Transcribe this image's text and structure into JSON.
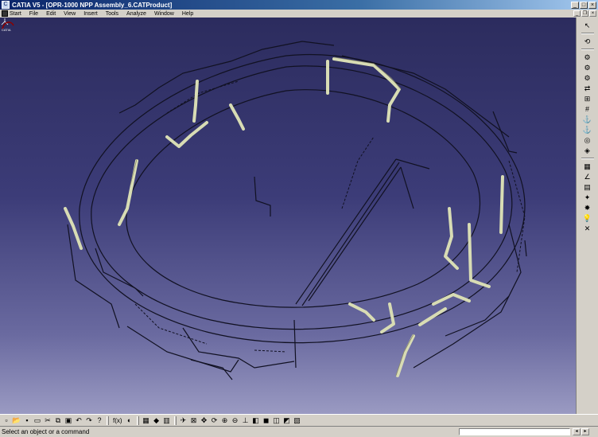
{
  "window": {
    "title": "CATIA V5 - [OPR-1000 NPP Assembly_6.CATProduct]",
    "app_icon": "catia-app-icon",
    "controls": [
      "minimize",
      "maximize",
      "close"
    ]
  },
  "menu": {
    "items": [
      "Start",
      "File",
      "Edit",
      "View",
      "Insert",
      "Tools",
      "Analyze",
      "Window",
      "Help"
    ]
  },
  "right_toolbar": {
    "icons": [
      "select-arrow-icon",
      "compass-icon",
      "product-icon",
      "new-component-icon",
      "existing-component-icon",
      "replace-icon",
      "graph-tree-icon",
      "generate-numbering-icon",
      "constraint-icon",
      "fix-icon",
      "coincidence-icon",
      "contact-icon",
      "offset-icon",
      "angle-icon",
      "snap-icon",
      "explode-icon",
      "clash-icon",
      "sectioning-icon",
      "measure-icon",
      "light-bulb-icon",
      "update-icon"
    ]
  },
  "bottom_toolbar": {
    "icons": [
      "new-icon",
      "open-icon",
      "save-icon",
      "print-icon",
      "cut-icon",
      "copy-icon",
      "paste-icon",
      "undo-icon",
      "redo-icon",
      "whats-this-icon",
      "fx-formula-icon",
      "knowledge-icon",
      "catalog-icon",
      "material-icon",
      "hide-show-icon",
      "fly-mode-icon",
      "fit-all-icon",
      "pan-icon",
      "rotate-icon",
      "zoom-in-icon",
      "zoom-out-icon",
      "normal-view-icon",
      "iso-view-icon",
      "shading-icon",
      "hide-icon",
      "swap-visible-icon",
      "normal-view2-icon"
    ],
    "formula_label": "f(x)"
  },
  "status": {
    "message": "Select an object or a command",
    "command_value": ""
  },
  "colors": {
    "viewport_top": "#2c2c5e",
    "viewport_bottom": "#9a9ac2",
    "pipe_color": "#d8dcb4",
    "structure_color": "#111122"
  }
}
